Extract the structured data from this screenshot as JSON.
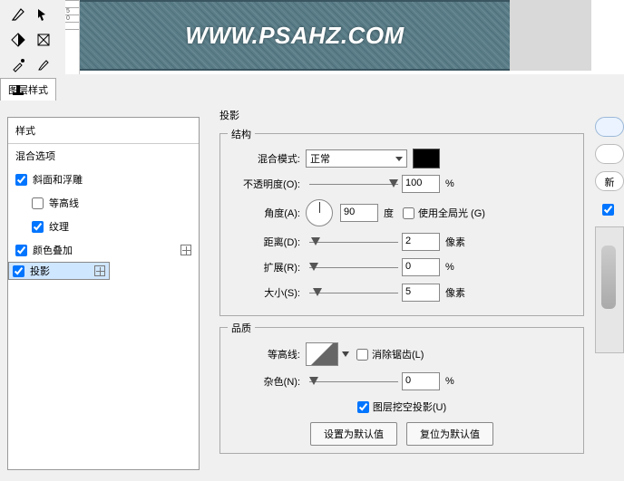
{
  "watermark": "WWW.PSAHZ.COM",
  "dialog_title": "图层样式",
  "styles_header": "样式",
  "blend_options": "混合选项",
  "style_items": {
    "bevel": "斜面和浮雕",
    "contour": "等高线",
    "texture": "纹理",
    "color_overlay": "颜色叠加",
    "drop_shadow": "投影"
  },
  "panel_title": "投影",
  "group_structure": "结构",
  "group_quality": "品质",
  "labels": {
    "blend_mode": "混合模式:",
    "opacity": "不透明度(O):",
    "angle": "角度(A):",
    "distance": "距离(D):",
    "spread": "扩展(R):",
    "size": "大小(S):",
    "contour": "等高线:",
    "noise": "杂色(N):"
  },
  "blend_mode_value": "正常",
  "opacity_value": "100",
  "angle_value": "90",
  "distance_value": "2",
  "spread_value": "0",
  "size_value": "5",
  "noise_value": "0",
  "units": {
    "degree": "度",
    "px": "像素",
    "pct": "%"
  },
  "global_light": "使用全局光 (G)",
  "antialias": "消除锯齿(L)",
  "knockout": "图层挖空投影(U)",
  "btn_default": "设置为默认值",
  "btn_reset": "复位为默认值",
  "right_label": "新"
}
